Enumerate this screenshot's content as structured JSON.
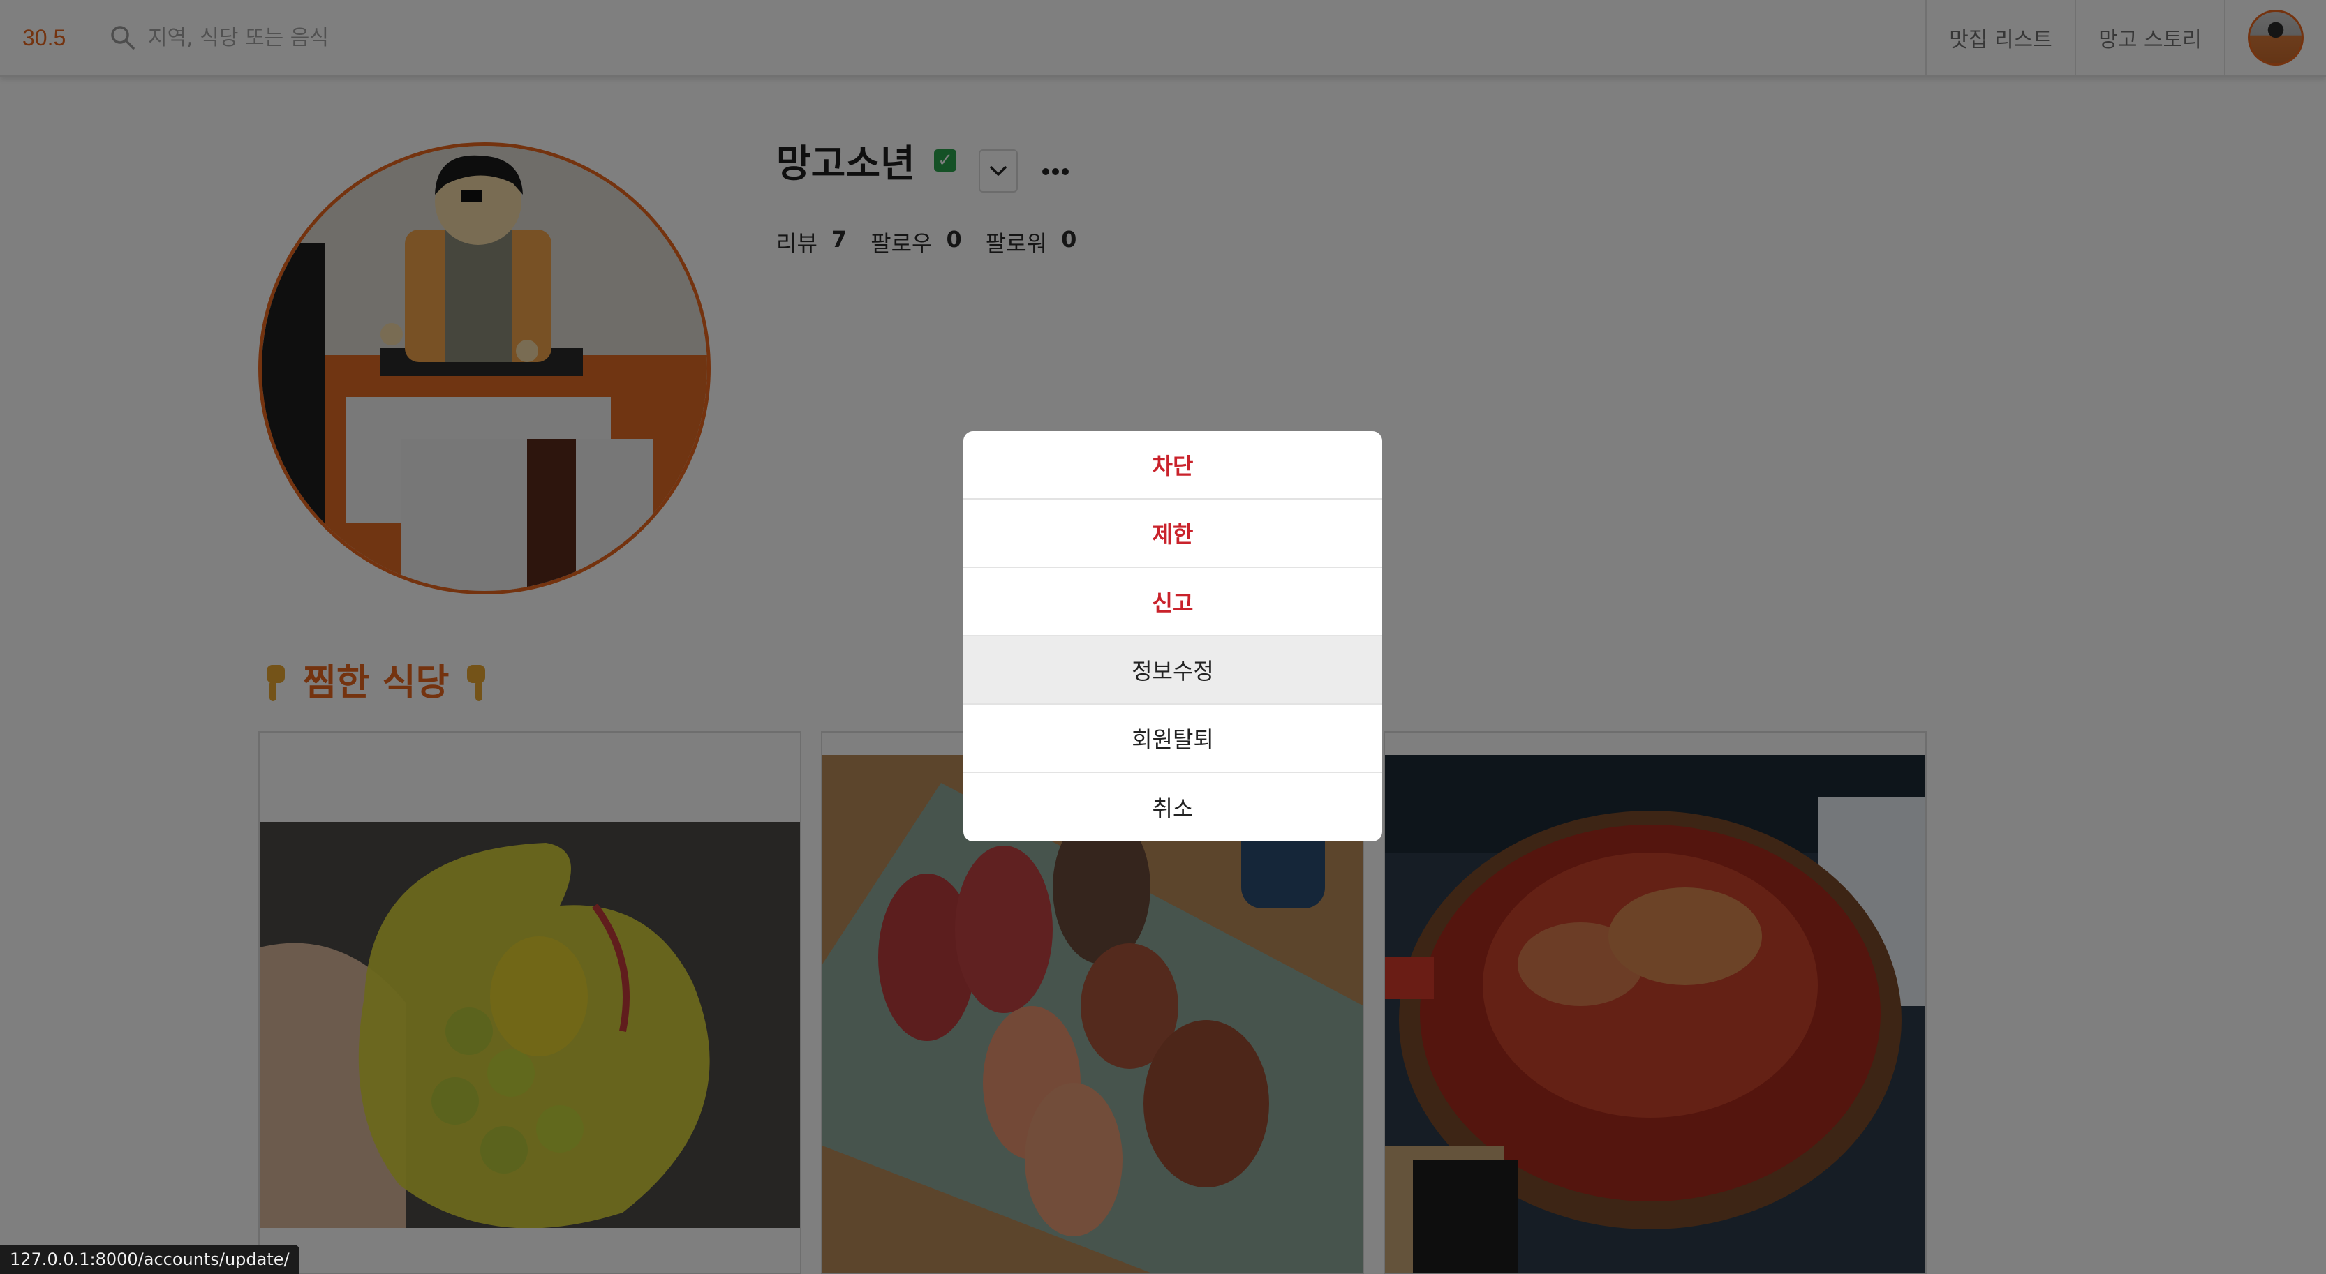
{
  "header": {
    "logo": "30.5",
    "search_placeholder": "지역, 식당 또는 음식",
    "nav": {
      "list_label": "맛집 리스트",
      "story_label": "망고 스토리"
    }
  },
  "profile": {
    "name": "망고소년",
    "verified_mark": "✓",
    "stats": [
      {
        "label": "리뷰",
        "value": "7"
      },
      {
        "label": "팔로우",
        "value": "0"
      },
      {
        "label": "팔로워",
        "value": "0"
      }
    ]
  },
  "section": {
    "title": "찜한 식당"
  },
  "modal": {
    "items": [
      {
        "label": "차단"
      },
      {
        "label": "제한"
      },
      {
        "label": "신고"
      },
      {
        "label": "정보수정"
      },
      {
        "label": "회원탈퇴"
      },
      {
        "label": "취소"
      }
    ]
  },
  "status_bar": {
    "url": "127.0.0.1:8000/accounts/update/"
  },
  "colors": {
    "accent": "#e8661f",
    "danger": "#c9222b",
    "overlay": "rgba(0,0,0,0.5)"
  }
}
